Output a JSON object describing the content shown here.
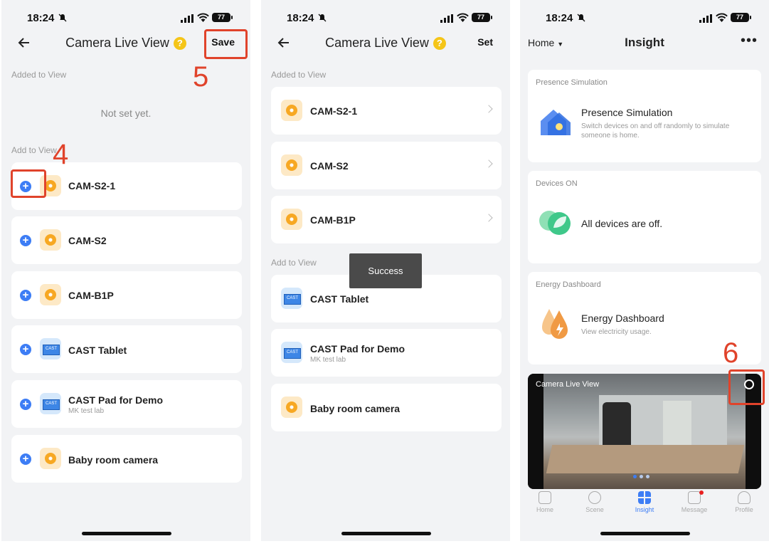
{
  "status": {
    "time": "18:24",
    "battery": "77"
  },
  "screen1": {
    "title": "Camera Live View",
    "save_label": "Save",
    "added_label": "Added to View",
    "empty_text": "Not set yet.",
    "add_label": "Add to View",
    "devices": [
      {
        "name": "CAM-S2-1",
        "sub": "",
        "icon": "camera-icon"
      },
      {
        "name": "CAM-S2",
        "sub": "",
        "icon": "camera-icon"
      },
      {
        "name": "CAM-B1P",
        "sub": "",
        "icon": "camera-icon"
      },
      {
        "name": "CAST Tablet",
        "sub": "",
        "icon": "tablet-icon"
      },
      {
        "name": "CAST Pad for Demo",
        "sub": "MK test lab",
        "icon": "tablet-icon"
      },
      {
        "name": "Baby room camera",
        "sub": "",
        "icon": "camera-icon"
      }
    ]
  },
  "screen2": {
    "title": "Camera Live View",
    "set_label": "Set",
    "added_label": "Added to View",
    "added": [
      {
        "name": "CAM-S2-1"
      },
      {
        "name": "CAM-S2"
      },
      {
        "name": "CAM-B1P"
      }
    ],
    "add_label": "Add to View",
    "devices": [
      {
        "name": "CAST Tablet",
        "sub": ""
      },
      {
        "name": "CAST Pad for Demo",
        "sub": "MK test lab"
      },
      {
        "name": "Baby room camera",
        "sub": ""
      }
    ],
    "toast": "Success"
  },
  "screen3": {
    "home_label": "Home",
    "title": "Insight",
    "cards": [
      {
        "caption": "Presence Simulation",
        "title": "Presence Simulation",
        "sub": "Switch devices on and off randomly to simulate someone is home."
      },
      {
        "caption": "Devices ON",
        "title": "All devices are off.",
        "sub": ""
      },
      {
        "caption": "Energy Dashboard",
        "title": "Energy Dashboard",
        "sub": "View electricity usage."
      }
    ],
    "camera_view_label": "Camera Live View",
    "tabs": [
      {
        "label": "Home",
        "active": false
      },
      {
        "label": "Scene",
        "active": false
      },
      {
        "label": "Insight",
        "active": true
      },
      {
        "label": "Message",
        "active": false
      },
      {
        "label": "Profile",
        "active": false
      }
    ]
  },
  "annotations": {
    "step4": "4",
    "step5": "5",
    "step6": "6"
  },
  "colors": {
    "accent": "#3d7df5",
    "highlight": "#e0432b",
    "camera_icon": "#f7a823"
  }
}
